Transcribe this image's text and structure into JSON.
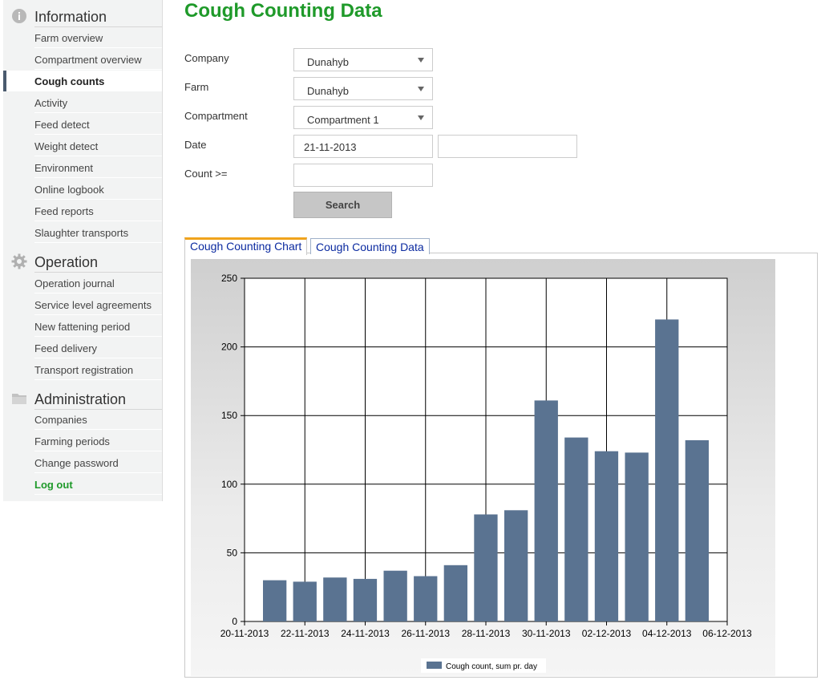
{
  "sidebar": {
    "sections": [
      {
        "title": "Information",
        "icon": "info-icon",
        "items": [
          "Farm overview",
          "Compartment overview",
          "Cough counts",
          "Activity",
          "Feed detect",
          "Weight detect",
          "Environment",
          "Online logbook",
          "Feed reports",
          "Slaughter transports"
        ]
      },
      {
        "title": "Operation",
        "icon": "gear-icon",
        "items": [
          "Operation journal",
          "Service level agreements",
          "New fattening period",
          "Feed delivery",
          "Transport registration"
        ]
      },
      {
        "title": "Administration",
        "icon": "folder-icon",
        "items": [
          "Companies",
          "Farming periods",
          "Change password",
          "Log out"
        ]
      }
    ],
    "active_item": "Cough counts"
  },
  "page": {
    "title": "Cough Counting Data"
  },
  "form": {
    "company_label": "Company",
    "company_value": "Dunahyb",
    "farm_label": "Farm",
    "farm_value": "Dunahyb",
    "compartment_label": "Compartment",
    "compartment_value": "Compartment 1",
    "date_label": "Date",
    "date_from": "21-11-2013",
    "date_to": "",
    "count_label": "Count >=",
    "count_value": "",
    "search_label": "Search"
  },
  "tabs": {
    "chart": "Cough Counting Chart",
    "data": "Cough Counting Data",
    "active": "chart"
  },
  "chart_data": {
    "type": "bar",
    "x_tick_labels": [
      "20-11-2013",
      "22-11-2013",
      "24-11-2013",
      "26-11-2013",
      "28-11-2013",
      "30-11-2013",
      "02-12-2013",
      "04-12-2013",
      "06-12-2013"
    ],
    "categories": [
      "21-11-2013",
      "22-11-2013",
      "23-11-2013",
      "24-11-2013",
      "25-11-2013",
      "26-11-2013",
      "27-11-2013",
      "28-11-2013",
      "29-11-2013",
      "30-11-2013",
      "01-12-2013",
      "02-12-2013",
      "03-12-2013",
      "04-12-2013",
      "05-12-2013"
    ],
    "values": [
      30,
      29,
      32,
      31,
      37,
      33,
      41,
      78,
      81,
      161,
      134,
      124,
      123,
      220,
      132
    ],
    "ylim": [
      0,
      250
    ],
    "yticks": [
      0,
      50,
      100,
      150,
      200,
      250
    ],
    "grid": true,
    "legend_position": "bottom-center",
    "series": [
      {
        "name": "Cough count, sum pr. day",
        "color": "#5a7391"
      }
    ],
    "bar_color": "#5a7391"
  }
}
